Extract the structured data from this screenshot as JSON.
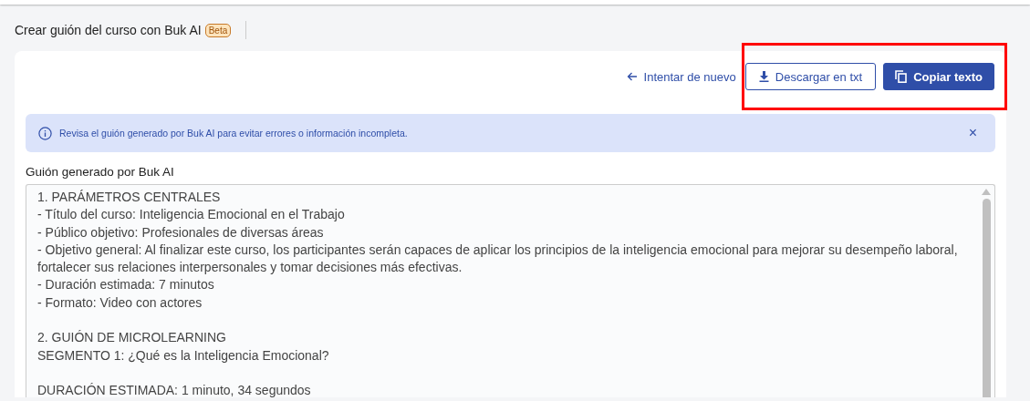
{
  "header": {
    "title": "Crear guión del curso con Buk AI",
    "badge": "Beta"
  },
  "actions": [
    {
      "kind": "link",
      "label": "Intentar de nuevo"
    },
    {
      "kind": "outline",
      "label": "Descargar en txt"
    },
    {
      "kind": "primary",
      "label": "Copiar texto"
    }
  ],
  "alert": {
    "message": "Revisa el guión generado por Buk AI para evitar errores o información incompleta.",
    "close": "×"
  },
  "script": {
    "label": "Guión generado por Buk AI",
    "blocks": [
      [
        "1. PARÁMETROS CENTRALES",
        "- Título del curso: Inteligencia Emocional en el Trabajo",
        "- Público objetivo: Profesionales de diversas áreas",
        "- Objetivo general: Al finalizar este curso, los participantes serán capaces de aplicar los principios de la inteligencia emocional para mejorar su desempeño laboral, fortalecer sus relaciones interpersonales y tomar decisiones más efectivas.",
        "- Duración estimada: 7 minutos",
        "- Formato: Video con actores"
      ],
      [
        "2. GUIÓN DE MICROLEARNING",
        "SEGMENTO 1: ¿Qué es la Inteligencia Emocional?"
      ],
      [
        "DURACIÓN ESTIMADA: 1 minuto, 34 segundos"
      ]
    ]
  },
  "annotations": [
    {
      "kind": "rectangle",
      "color": "#ff0000"
    }
  ]
}
